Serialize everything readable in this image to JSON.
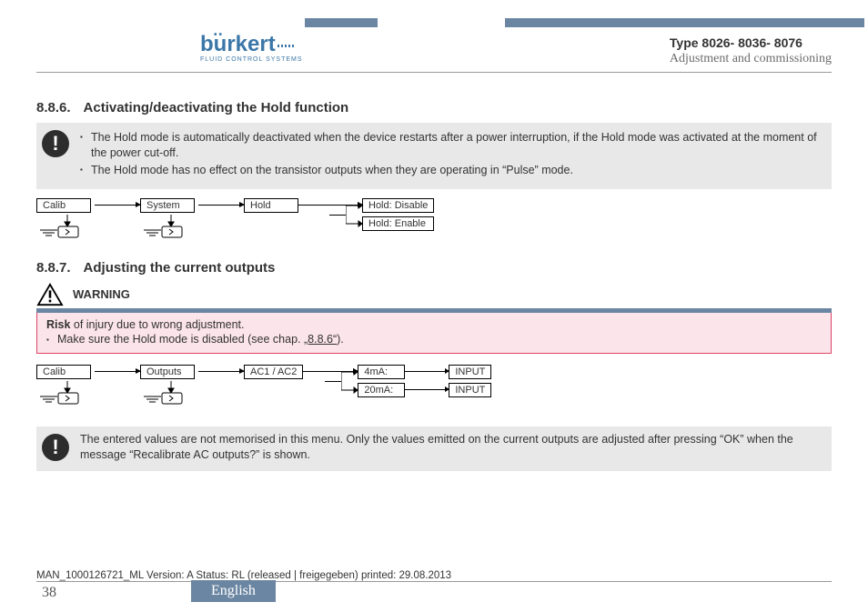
{
  "header": {
    "brand": "burkert",
    "tagline": "FLUID CONTROL SYSTEMS",
    "type_line": "Type 8026- 8036- 8076",
    "subtitle": "Adjustment and commissioning"
  },
  "section1": {
    "number": "8.8.6.",
    "title": "Activating/deactivating the Hold function",
    "notice": {
      "items": [
        "The Hold mode is automatically deactivated when the device restarts after a power interruption, if the Hold mode was activated at the moment of the power cut-off.",
        "The Hold mode has no effect on the transistor outputs when they are operating in “Pulse” mode."
      ]
    },
    "chain": {
      "n1": "Calib",
      "n2": "System",
      "n3": "Hold",
      "branch": {
        "a": "Hold: Disable",
        "b": "Hold: Enable"
      }
    }
  },
  "section2": {
    "number": "8.8.7.",
    "title": "Adjusting the current outputs",
    "warning": {
      "label": "WARNING",
      "risk_bold": "Risk",
      "risk_rest": " of injury due to wrong adjustment.",
      "line_pre": "Make sure the Hold mode is disabled (see chap. ",
      "line_ref": "„8.8.6“",
      "line_post": ")."
    },
    "chain": {
      "n1": "Calib",
      "n2": "Outputs",
      "n3": "AC1 / AC2",
      "branch": {
        "a": {
          "label": "4mA:",
          "target": "INPUT"
        },
        "b": {
          "label": "20mA:",
          "target": "INPUT"
        }
      }
    },
    "notice2": "The entered values are not memorised in this menu. Only the values emitted on the current outputs are adjusted after pressing “OK” when the message “Recalibrate AC outputs?” is shown."
  },
  "footer": {
    "meta": "MAN_1000126721_ML  Version: A Status: RL (released | freigegeben)  printed: 29.08.2013",
    "page": "38",
    "language": "English"
  }
}
